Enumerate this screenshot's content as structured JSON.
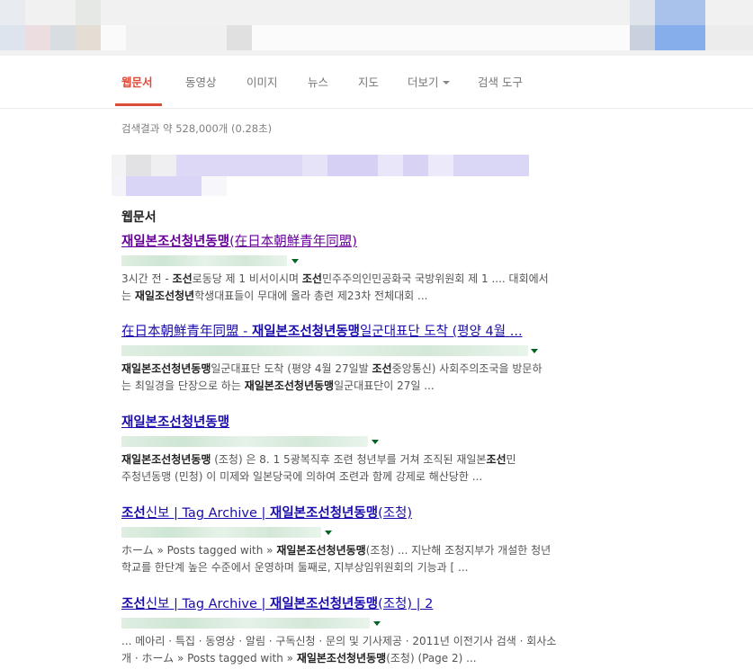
{
  "tabs": {
    "web": "웹문서",
    "video": "동영상",
    "images": "이미지",
    "news": "뉴스",
    "maps": "지도",
    "more": "더보기",
    "tools": "검색 도구"
  },
  "stats": "검색결과 약 528,000개 (0.28초)",
  "section_heading": "웹문서",
  "results": [
    {
      "title": "재일본조선청년동맹(在日本朝鮮青年同盟)",
      "snippet": [
        "3시간 전 - 조선로동당 제 1 비서이시며 조선민주주의인민공화국 국방위원회 제 1 .... 대회에서",
        "는 재일조선청년학생대표들이 무대에 올라 총련 제23차 전체대회 ..."
      ]
    },
    {
      "title": "在日本朝鮮青年同盟 - 재일본조선청년동맹일군대표단 도착 (평양 4월 ...",
      "snippet": [
        "재일본조선청년동맹일군대표단 도착 (평양 4월 27일발 조선중앙통신) 사회주의조국을 방문하",
        "는 최일경을 단장으로 하는 재일본조선청년동맹일군대표단이 27일 ..."
      ]
    },
    {
      "title": "재일본조선청년동맹",
      "snippet": [
        "재일본조선청년동맹 (조청) 은 8. 1 5광복직후 조련 청년부를 거쳐 조직된 재일본조선민",
        "주청년동맹 (민청) 이 미제와 일본당국에 의하여 조련과 함께 강제로 해산당한 ..."
      ]
    },
    {
      "title": "조선신보 | Tag Archive | 재일본조선청년동맹(조청)",
      "snippet": [
        "ホーム » Posts tagged with » 재일본조선청년동맹(조청) ... 지난해 조청지부가 개설한 청년",
        "학교를 한단계 높은 수준에서 운영하며 둘째로, 지부상임위원회의 기능과 [ ..."
      ]
    },
    {
      "title": "조선신보 | Tag Archive | 재일본조선청년동맹(조청) | 2",
      "snippet": [
        "... 메아리 · 특집 · 동영상 · 알림 · 구독신청 · 문의 및 기사제공 · 2011년 이전기사 검색 · 회사소",
        "개 · ホーム » Posts tagged with » 재일본조선청년동맹(조청) (Page 2) ..."
      ]
    }
  ]
}
